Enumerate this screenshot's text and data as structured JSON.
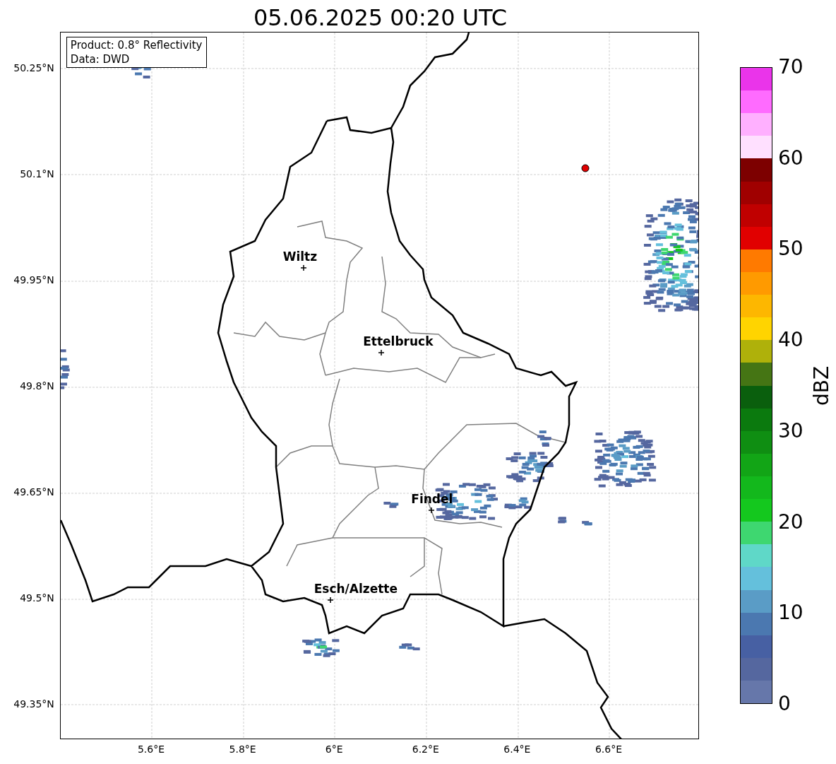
{
  "title": "05.06.2025 00:20 UTC",
  "info_box": [
    "Product: 0.8° Reflectivity",
    "Data: DWD"
  ],
  "map": {
    "y_ticks": [
      "50.25°N",
      "50.1°N",
      "49.95°N",
      "49.8°N",
      "49.65°N",
      "49.5°N",
      "49.35°N"
    ],
    "x_ticks": [
      "5.6°E",
      "5.8°E",
      "6°E",
      "6.2°E",
      "6.4°E",
      "6.6°E"
    ],
    "cities": [
      {
        "name": "Wiltz"
      },
      {
        "name": "Ettelbruck"
      },
      {
        "name": "Findel"
      },
      {
        "name": "Esch/Alzette"
      }
    ]
  },
  "colorbar": {
    "label": "dBZ",
    "ticks": [
      "70",
      "60",
      "50",
      "40",
      "30",
      "20",
      "10",
      "0"
    ],
    "bands": [
      {
        "color": "#6677aa"
      },
      {
        "color": "#55679f"
      },
      {
        "color": "#4760a3"
      },
      {
        "color": "#4b78b0"
      },
      {
        "color": "#5a9cc6"
      },
      {
        "color": "#64c0dc"
      },
      {
        "color": "#5fd8c8"
      },
      {
        "color": "#3ed770"
      },
      {
        "color": "#14c81e"
      },
      {
        "color": "#13b81c"
      },
      {
        "color": "#12a516"
      },
      {
        "color": "#0f8e12"
      },
      {
        "color": "#0b7a0e"
      },
      {
        "color": "#0a5f0d"
      },
      {
        "color": "#457514"
      },
      {
        "color": "#afb10a"
      },
      {
        "color": "#ffd400"
      },
      {
        "color": "#fdb700"
      },
      {
        "color": "#ff9a00"
      },
      {
        "color": "#ff7a00"
      },
      {
        "color": "#e10000"
      },
      {
        "color": "#c00000"
      },
      {
        "color": "#a00000"
      },
      {
        "color": "#7d0000"
      },
      {
        "color": "#ffe0ff"
      },
      {
        "color": "#ffb0ff"
      },
      {
        "color": "#ff6bff"
      },
      {
        "color": "#ea34ea"
      }
    ]
  }
}
